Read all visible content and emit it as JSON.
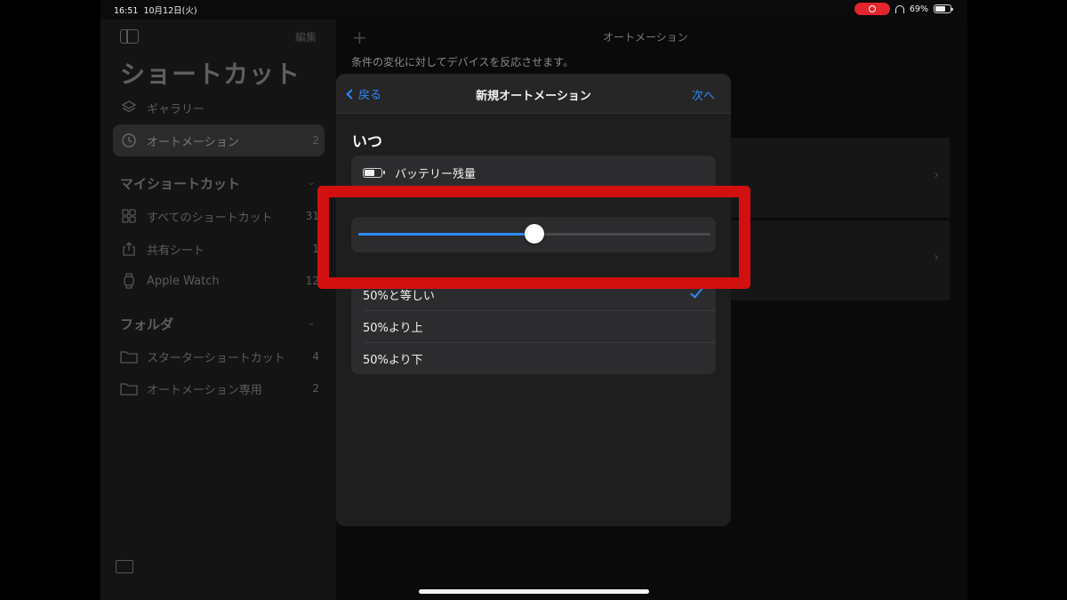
{
  "status_bar": {
    "time": "16:51",
    "date": "10月12日(火)",
    "battery_percent": "69%",
    "battery_level": 0.69,
    "recording_color": "#e2262c"
  },
  "sidebar": {
    "edit_label": "編集",
    "title": "ショートカット",
    "items": [
      {
        "label": "ギャラリー",
        "count": "",
        "icon": "layers-icon"
      },
      {
        "label": "オートメーション",
        "count": "2",
        "icon": "clock-icon",
        "selected": true
      }
    ],
    "my_shortcuts": {
      "header": "マイショートカット",
      "items": [
        {
          "label": "すべてのショートカット",
          "count": "31",
          "icon": "grid-icon"
        },
        {
          "label": "共有シート",
          "count": "1",
          "icon": "share-icon"
        },
        {
          "label": "Apple Watch",
          "count": "12",
          "icon": "watch-icon"
        }
      ]
    },
    "folders": {
      "header": "フォルダ",
      "items": [
        {
          "label": "スターターショートカット",
          "count": "4",
          "icon": "folder-icon"
        },
        {
          "label": "オートメーション専用",
          "count": "2",
          "icon": "folder-icon"
        }
      ]
    }
  },
  "main": {
    "title": "オートメーション",
    "description": "条件の変化に対してデバイスを反応させます。"
  },
  "modal": {
    "back_label": "戻る",
    "title": "新規オートメーション",
    "next_label": "次へ",
    "when_heading": "いつ",
    "trigger_label": "バッテリー残量",
    "slider_value": 0.5,
    "options": [
      {
        "label": "50%と等しい",
        "checked": true
      },
      {
        "label": "50%より上",
        "checked": false
      },
      {
        "label": "50%より下",
        "checked": false
      }
    ]
  },
  "colors": {
    "accent": "#2c8bff",
    "highlight": "#d21010"
  }
}
